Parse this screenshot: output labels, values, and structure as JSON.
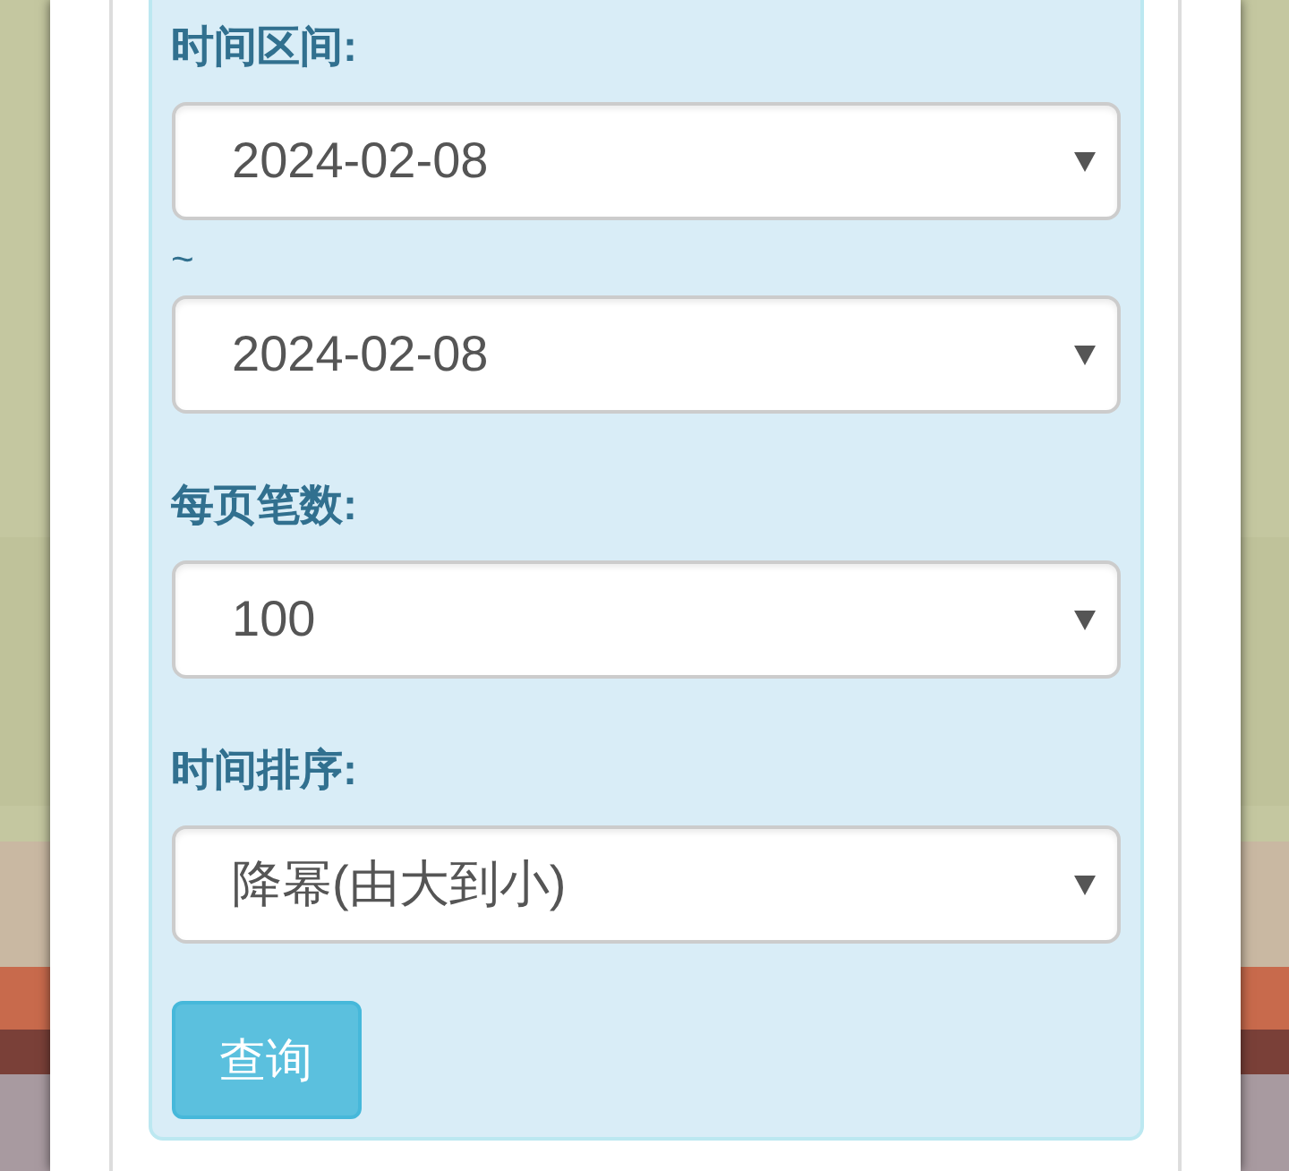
{
  "filters": [
    {
      "kind": "range",
      "label": "时间区间:",
      "from": "2024-02-08",
      "separator": "~",
      "to": "2024-02-08"
    },
    {
      "kind": "select",
      "label": "每页笔数:",
      "value": "100"
    },
    {
      "kind": "select",
      "label": "时间排序:",
      "value": "降幂(由大到小)"
    }
  ],
  "button": "查询"
}
